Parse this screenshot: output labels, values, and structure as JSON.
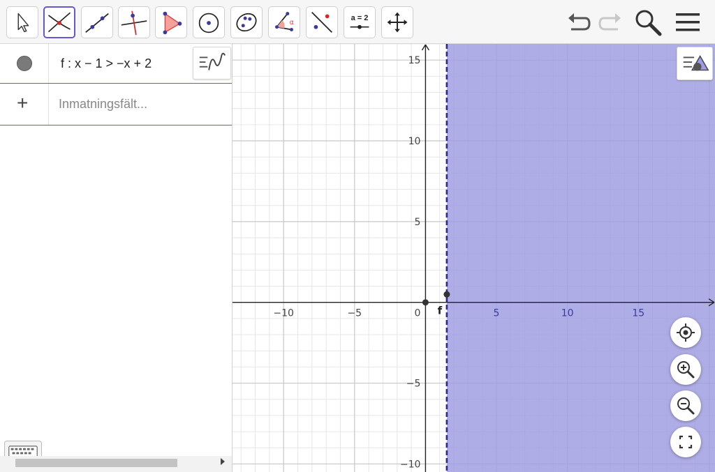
{
  "toolbar": {
    "tools": [
      {
        "name": "move-tool",
        "icon": "arrow-cursor-icon"
      },
      {
        "name": "intersect-tool",
        "icon": "intersect-icon",
        "active": true
      },
      {
        "name": "line-tool",
        "icon": "line-through-points-icon"
      },
      {
        "name": "perpendicular-tool",
        "icon": "perpendicular-line-icon"
      },
      {
        "name": "polygon-tool",
        "icon": "polygon-icon"
      },
      {
        "name": "circle-tool",
        "icon": "circle-center-point-icon"
      },
      {
        "name": "conic-tool",
        "icon": "ellipse-icon"
      },
      {
        "name": "angle-tool",
        "icon": "angle-icon"
      },
      {
        "name": "reflect-tool",
        "icon": "reflect-point-icon"
      },
      {
        "name": "slider-tool",
        "icon": "slider-icon",
        "label": "a = 2"
      },
      {
        "name": "move-graphics-tool",
        "icon": "move-arrows-icon"
      }
    ],
    "right_icons": [
      "undo-icon",
      "redo-icon",
      "search-icon",
      "menu-icon"
    ]
  },
  "algebra": {
    "entries": [
      {
        "label": "f",
        "expression": "f : x − 1 > −x + 2",
        "color": "#7a7a7a"
      }
    ],
    "input": {
      "placeholder": "Inmatningsfält..."
    }
  },
  "graphics": {
    "x_ticks": [
      -10,
      -5,
      0,
      5,
      10,
      15
    ],
    "y_ticks": [
      -10,
      -5,
      5,
      10,
      15
    ],
    "x_range": [
      -13.6,
      20.4
    ],
    "y_range": [
      -10.5,
      16.0
    ],
    "region": {
      "type": "inequality",
      "boundary_x": 1.5,
      "side": "right",
      "fill": "#9d9be1",
      "boundary_color": "#2a2a88"
    },
    "region_label": "f",
    "points": [
      {
        "x": 0,
        "y": 0
      },
      {
        "x": 1.5,
        "y": 0.5
      }
    ],
    "colors": {
      "accent": "#6557d2",
      "axis": "#222222",
      "grid_major": "#c7c7c7",
      "grid_minor": "#e6e6e6"
    }
  }
}
